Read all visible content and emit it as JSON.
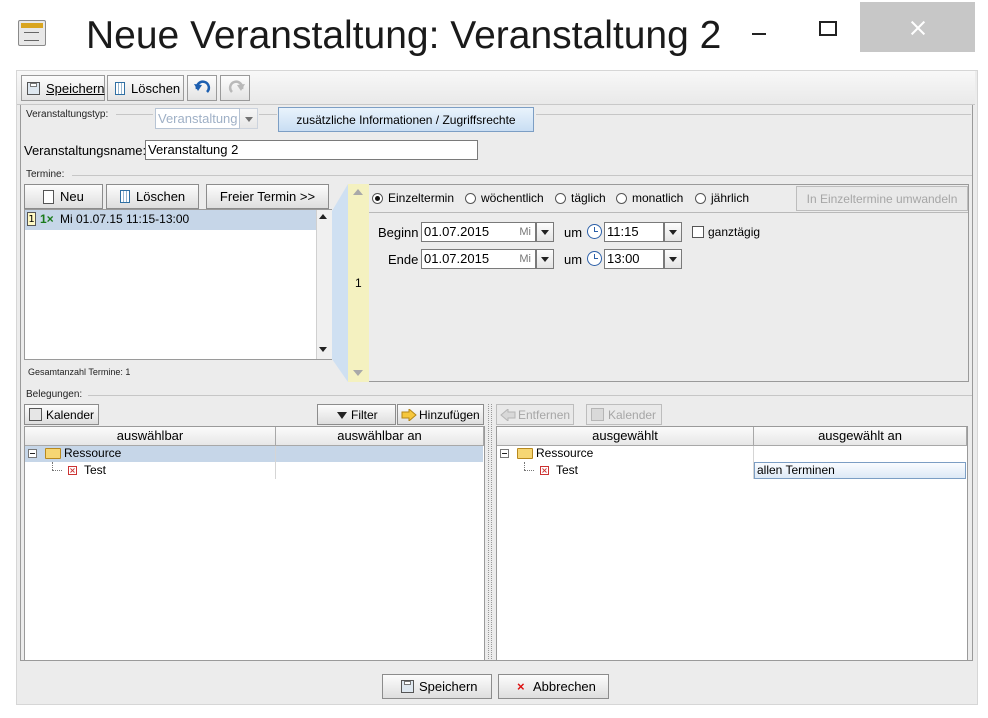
{
  "window": {
    "title": "Neue Veranstaltung: Veranstaltung 2"
  },
  "toolbar": {
    "save_label": "Speichern",
    "delete_label": "Löschen"
  },
  "event": {
    "type_label": "Veranstaltungstyp:",
    "type_value": "Veranstaltung",
    "extra_info_button": "zusätzliche Informationen / Zugriffsrechte",
    "name_label": "Veranstaltungsname:",
    "name_value": "Veranstaltung 2"
  },
  "termine": {
    "section_label": "Termine:",
    "new_button": "Neu",
    "delete_button": "Löschen",
    "free_button": "Freier Termin >>",
    "list": [
      {
        "index": "1",
        "count": "1×",
        "text": "Mi 01.07.15 11:15-13:00"
      }
    ],
    "total_label": "Gesamtanzahl Termine: 1",
    "side_index": "1"
  },
  "recurrence": {
    "options": [
      "Einzeltermin",
      "wöchentlich",
      "täglich",
      "monatlich",
      "jährlich"
    ],
    "selected": "Einzeltermin",
    "convert_button": "In Einzeltermine umwandeln",
    "begin_label": "Beginn",
    "begin_date": "01.07.2015",
    "begin_weekday": "Mi",
    "at_label": "um",
    "begin_time": "11:15",
    "allday_label": "ganztägig",
    "end_label": "Ende",
    "end_date": "01.07.2015",
    "end_weekday": "Mi",
    "end_time": "13:00"
  },
  "belegungen": {
    "section_label": "Belegungen:",
    "calendar_button": "Kalender",
    "filter_button": "Filter",
    "add_button": "Hinzufügen",
    "remove_button": "Entfernen",
    "calendar_button_right": "Kalender",
    "left_columns": [
      "auswählbar",
      "auswählbar an"
    ],
    "right_columns": [
      "ausgewählt",
      "ausgewählt an"
    ],
    "left_tree": {
      "group": "Ressource",
      "item": "Test"
    },
    "right_tree": {
      "group": "Ressource",
      "item": "Test",
      "assigned": "allen Terminen"
    }
  },
  "footer": {
    "save_label": "Speichern",
    "cancel_label": "Abbrechen"
  }
}
